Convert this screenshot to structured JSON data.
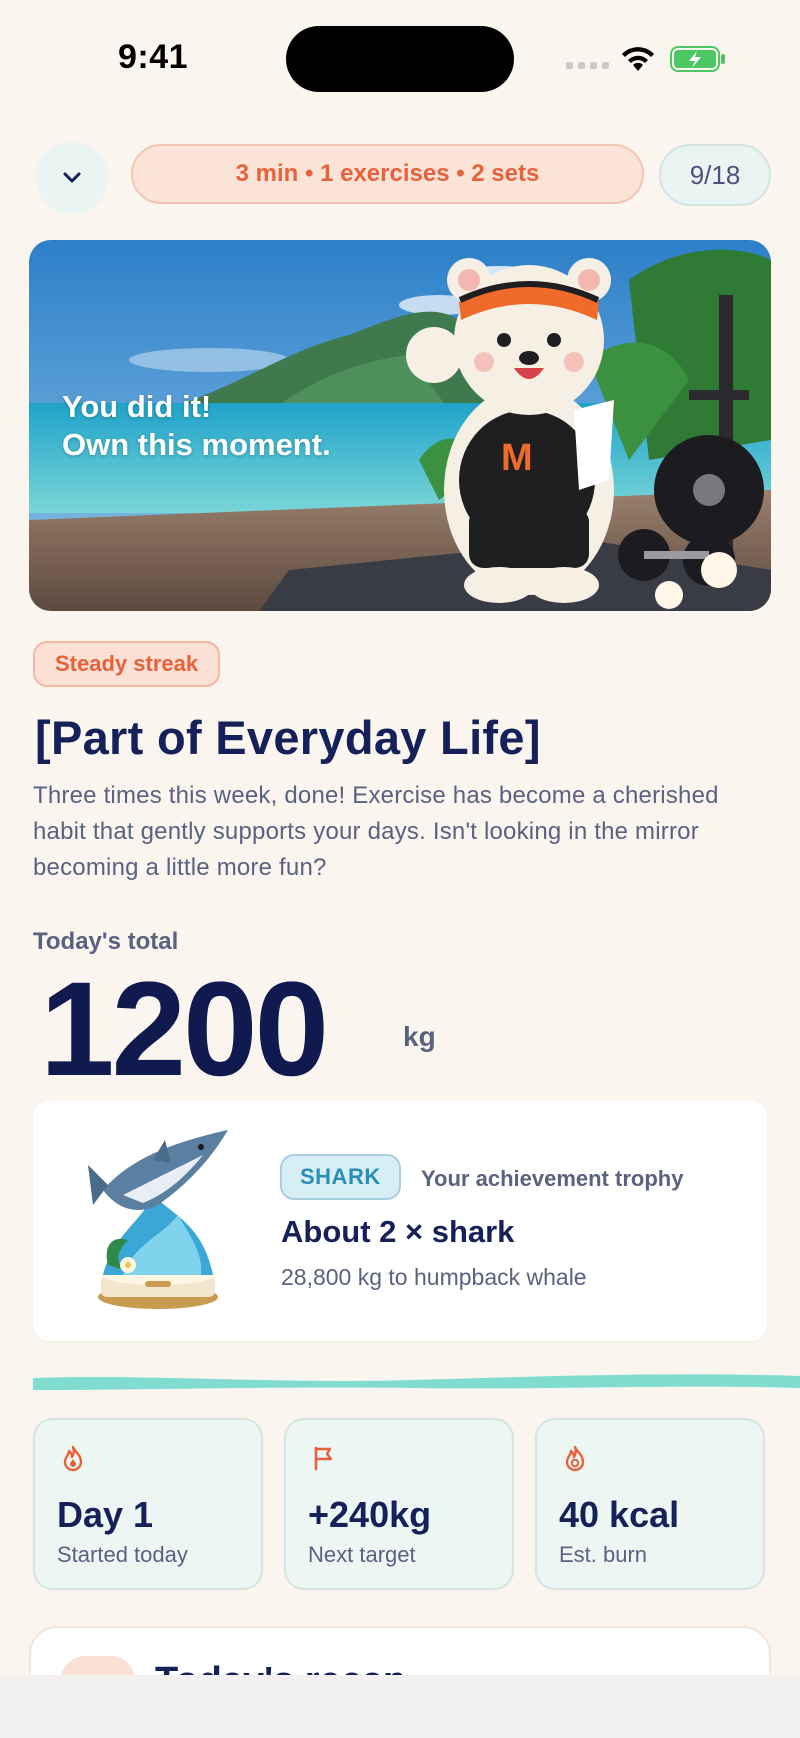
{
  "status_bar": {
    "time": "9:41"
  },
  "toolbar": {
    "summary": "3 min • 1 exercises • 2 sets",
    "progress": "9/18"
  },
  "hero": {
    "line1": "You did it!",
    "line2": "Own this moment.",
    "jersey_letter": "M"
  },
  "streak_badge": "Steady streak",
  "headline": "[Part of Everyday Life]",
  "description": "Three times this week, done! Exercise has become a cherished habit that gently supports your days. Isn't looking in the mirror becoming a little more fun?",
  "total": {
    "label": "Today's total",
    "value": "1200",
    "unit": "kg"
  },
  "trophy": {
    "tag": "SHARK",
    "caption": "Your achievement trophy",
    "title": "About 2 × shark",
    "subtitle": "28,800 kg to humpback whale"
  },
  "stats": [
    {
      "icon": "flame-icon",
      "value": "Day 1",
      "label": "Started today"
    },
    {
      "icon": "flag-icon",
      "value": "+240kg",
      "label": "Next target"
    },
    {
      "icon": "calorie-flame-icon",
      "value": "40 kcal",
      "label": "Est. burn"
    }
  ],
  "recap": {
    "title": "Today's recap"
  },
  "colors": {
    "accent": "#e7613a",
    "navy": "#16215a",
    "teal": "#7fdccf",
    "background": "#fbf5f0"
  }
}
